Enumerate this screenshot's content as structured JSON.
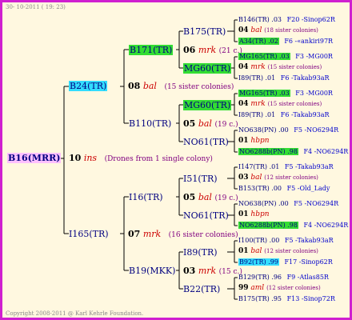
{
  "header": {
    "date": "30- 10-2011 ( 19: 23)"
  },
  "footer": {
    "copyright": "Copyright 2008-2011 @ Karl Kehrle Foundation."
  },
  "colors": {
    "border": "#d020d0",
    "root_bg": "#ffc0ff",
    "cyan_bg": "#33ddff",
    "green_bg": "#33dd33",
    "bg": "#fff8e0"
  },
  "root": {
    "id": "B16(MRR)",
    "no": "10",
    "code": "ins",
    "note": "(Drones from 1 single colony)"
  },
  "g1": [
    {
      "id": "B24(TR)",
      "no": "08",
      "code": "bal",
      "note": "(15 sister colonies)"
    },
    {
      "id": "I165(TR)",
      "no": "07",
      "code": "mrk",
      "note": "(16 sister colonies)"
    }
  ],
  "g2": [
    {
      "id": "B171(TR)",
      "no": "06",
      "code": "mrk",
      "note": "(21 c.)"
    },
    {
      "id": "B110(TR)",
      "no": "05",
      "code": "bal",
      "note": "(19 c.)"
    },
    {
      "id": "I16(TR)",
      "no": "05",
      "code": "bal",
      "note": "(19 c.)"
    },
    {
      "id": "B19(MKK)",
      "no": "03",
      "code": "mrk",
      "note": "(15 c.)"
    }
  ],
  "g3": [
    {
      "id": "B175(TR)"
    },
    {
      "id": "MG60(TR)"
    },
    {
      "id": "MG60(TR)"
    },
    {
      "id": "NO61(TR)"
    },
    {
      "id": "I51(TR)"
    },
    {
      "id": "NO61(TR)"
    },
    {
      "id": "I89(TR)"
    },
    {
      "id": "B22(TR)"
    }
  ],
  "g4": [
    {
      "a": "B146(TR) .03",
      "b": "F20 -Sinop62R",
      "c": "04",
      "d": "bal",
      "e": "(18 sister colonies)",
      "f": "A34(TR) .02",
      "g": "F6 -«ankiri97R"
    },
    {
      "a": "MG165(TR) .03",
      "b": "F3 -MG00R",
      "c": "04",
      "d": "mrk",
      "e": "(15 sister colonies)",
      "f": "I89(TR) .01",
      "g": "F6 -Takab93aR"
    },
    {
      "a": "MG165(TR) .03",
      "b": "F3 -MG00R",
      "c": "04",
      "d": "mrk",
      "e": "(15 sister colonies)",
      "f": "I89(TR) .01",
      "g": "F6 -Takab93aR"
    },
    {
      "a": "NO638(PN) .00",
      "b": "F5 -NO6294R",
      "c": "01",
      "d": "hbpn",
      "e": "",
      "f": "NO6288b(PN) .98",
      "g": "F4 -NO6294R"
    },
    {
      "a": "I147(TR) .01",
      "b": "F5 -Takab93aR",
      "c": "03",
      "d": "bal",
      "e": "(12 sister colonies)",
      "f": "B153(TR) .00",
      "g": "F5 -Old_Lady"
    },
    {
      "a": "NO638(PN) .00",
      "b": "F5 -NO6294R",
      "c": "01",
      "d": "hbpn",
      "e": "",
      "f": "NO6288b(PN) .98",
      "g": "F4 -NO6294R"
    },
    {
      "a": "I100(TR) .00",
      "b": "F5 -Takab93aR",
      "c": "01",
      "d": "bal",
      "e": "(12 sister colonies)",
      "f": "B92(TR) .99",
      "g": "F17 -Sinop62R"
    },
    {
      "a": "B129(TR) .96",
      "b": "F9 -Atlas85R",
      "c": "99",
      "d": "aml",
      "e": "(12 sister colonies)",
      "f": "B175(TR) .95",
      "g": "F13 -Sinop72R"
    }
  ]
}
